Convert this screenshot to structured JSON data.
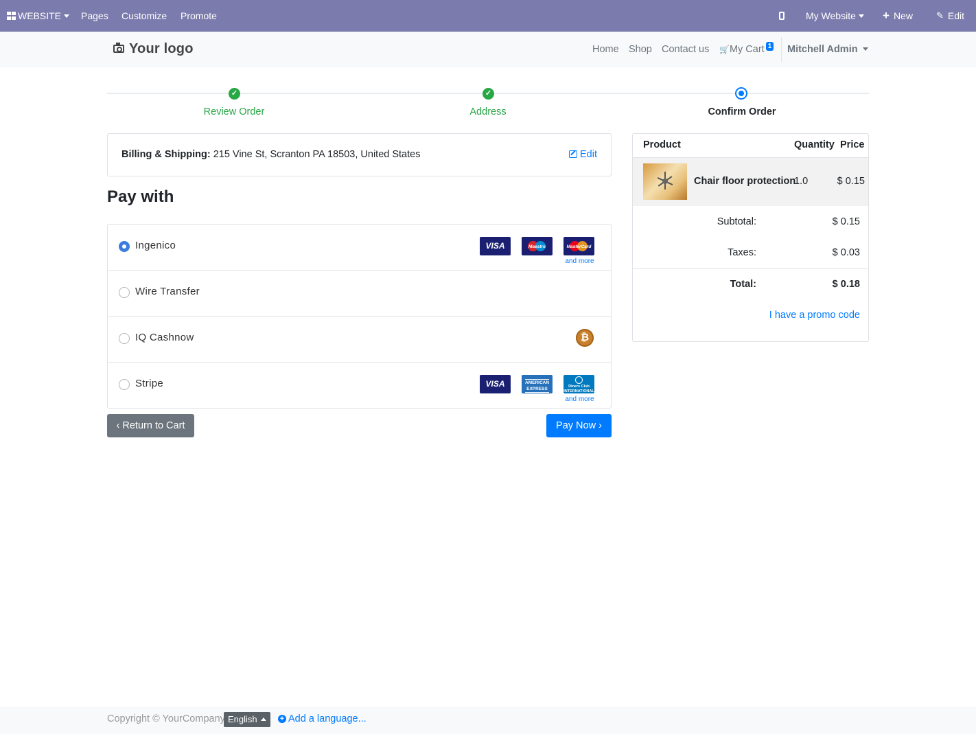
{
  "admin_bar": {
    "website_label": "WEBSITE",
    "pages_label": "Pages",
    "customize_label": "Customize",
    "promote_label": "Promote",
    "site_switcher_label": "My Website",
    "new_label": "New",
    "edit_label": "Edit",
    "background_color": "#7c7bad"
  },
  "header": {
    "logo_text": "Your logo",
    "nav": [
      "Home",
      "Shop",
      "Contact us"
    ],
    "cart_label": "My Cart",
    "cart_count": "1",
    "user_name": "Mitchell Admin"
  },
  "steps": [
    {
      "label": "Review Order",
      "state": "done"
    },
    {
      "label": "Address",
      "state": "done"
    },
    {
      "label": "Confirm Order",
      "state": "current"
    }
  ],
  "billing": {
    "label": "Billing & Shipping:",
    "address": " 215 Vine St, Scranton PA 18503, United States",
    "edit_label": "Edit"
  },
  "pay_with_title": "Pay with",
  "payment_methods": [
    {
      "name": "Ingenico",
      "selected": true,
      "cards": [
        "VISA",
        "Maestro",
        "MasterCard"
      ],
      "more": "and more"
    },
    {
      "name": "Wire Transfer",
      "selected": false
    },
    {
      "name": "IQ Cashnow",
      "selected": false,
      "icon": "bitcoin-icon"
    },
    {
      "name": "Stripe",
      "selected": false,
      "cards": [
        "VISA",
        "AMERICAN EXPRESS",
        "Diners Club INTERNATIONAL"
      ],
      "more": "and more"
    }
  ],
  "buttons": {
    "return_label": "Return to Cart",
    "pay_label": "Pay Now"
  },
  "order_summary": {
    "headers": {
      "product": "Product",
      "quantity": "Quantity",
      "price": "Price"
    },
    "line": {
      "product": "Chair floor protection",
      "quantity": "1.0",
      "price": "$ 0.15"
    },
    "subtotal_label": "Subtotal:",
    "subtotal": "$ 0.15",
    "taxes_label": "Taxes:",
    "taxes": "$ 0.03",
    "total_label": "Total:",
    "total": "$ 0.18",
    "promo_label": "I have a promo code"
  },
  "footer": {
    "copyright": "Copyright © YourCompany",
    "language": "English",
    "add_language": "Add a language..."
  },
  "colors": {
    "primary": "#007bff",
    "success": "#28a745",
    "secondary": "#6c757d"
  }
}
